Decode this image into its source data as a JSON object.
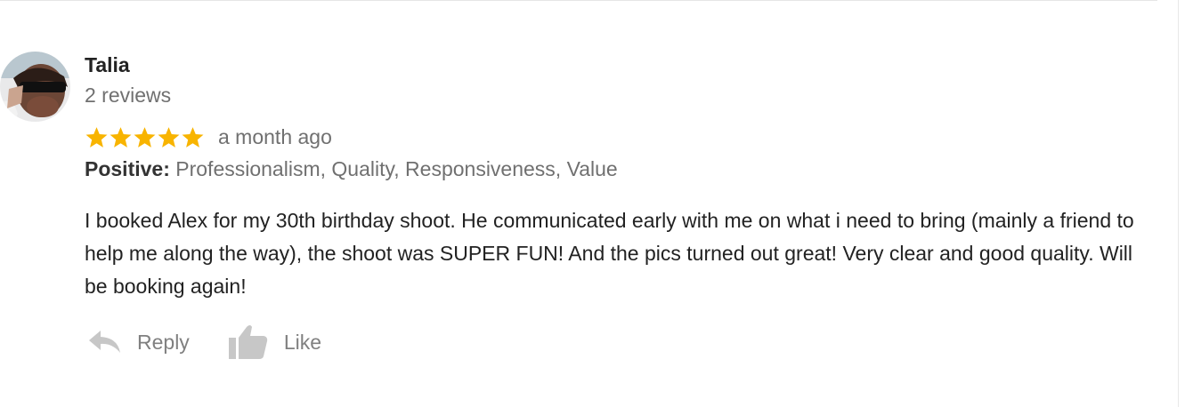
{
  "review": {
    "reviewer_name": "Talia",
    "review_count": "2 reviews",
    "rating": 5,
    "rating_max": 5,
    "date": "a month ago",
    "attributes_label": "Positive:",
    "attributes_value": "Professionalism, Quality, Responsiveness, Value",
    "text": "I booked Alex for my 30th birthday shoot. He communicated early with me on what i need to bring (mainly a friend to help me along the way), the shoot was SUPER FUN! And the pics turned out great! Very clear and good quality. Will be booking again!"
  },
  "actions": {
    "reply_label": "Reply",
    "like_label": "Like"
  },
  "icons": {
    "reply": "reply-arrow-icon",
    "like": "thumbs-up-icon",
    "star": "star-icon",
    "avatar": "avatar"
  },
  "colors": {
    "star": "#f8b400",
    "muted_text": "#707070",
    "action_gray": "#c7c7c7"
  }
}
